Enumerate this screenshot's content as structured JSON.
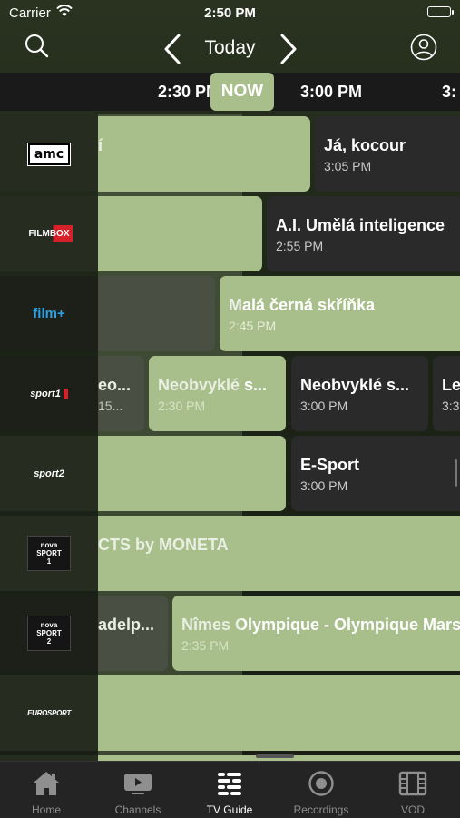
{
  "status": {
    "carrier": "Carrier",
    "time": "2:50 PM"
  },
  "header": {
    "day": "Today"
  },
  "timeline": {
    "ticks": [
      "2:30 PM",
      "3:00 PM",
      "3:"
    ],
    "now_label": "NOW"
  },
  "channels": [
    {
      "logo": "amc",
      "programs": [
        {
          "title": "í",
          "time": ""
        },
        {
          "title": "Já, kocour",
          "time": "3:05 PM"
        }
      ]
    },
    {
      "logo": "FILMBOX",
      "programs": [
        {
          "title": "",
          "time": ""
        },
        {
          "title": "A.I. Umělá inteligence",
          "time": "2:55 PM"
        }
      ]
    },
    {
      "logo": "film+",
      "programs": [
        {
          "title": "",
          "time": ""
        },
        {
          "title": "Malá černá skříňka",
          "time": "2:45 PM"
        }
      ]
    },
    {
      "logo": "sport1",
      "programs": [
        {
          "title": "eo...",
          "time": "15..."
        },
        {
          "title": "Neobvyklé s...",
          "time": "2:30 PM"
        },
        {
          "title": "Neobvyklé s...",
          "time": "3:00 PM"
        },
        {
          "title": "Le",
          "time": "3:3"
        }
      ]
    },
    {
      "logo": "sport2",
      "programs": [
        {
          "title": "",
          "time": ""
        },
        {
          "title": "E-Sport",
          "time": "3:00 PM"
        }
      ]
    },
    {
      "logo": "nova SPORT 1",
      "programs": [
        {
          "title": "CTS by MONETA",
          "time": ""
        }
      ]
    },
    {
      "logo": "nova SPORT 2",
      "programs": [
        {
          "title": "adelp...",
          "time": ""
        },
        {
          "title": "Nîmes Olympique - Olympique Mars",
          "time": "2:35 PM"
        }
      ]
    },
    {
      "logo": "EUROSPORT",
      "programs": [
        {
          "title": "",
          "time": ""
        }
      ]
    }
  ],
  "tabs": [
    {
      "label": "Home",
      "icon": "home-icon"
    },
    {
      "label": "Channels",
      "icon": "channels-icon"
    },
    {
      "label": "TV Guide",
      "icon": "tv-guide-icon"
    },
    {
      "label": "Recordings",
      "icon": "recordings-icon"
    },
    {
      "label": "VOD",
      "icon": "vod-icon"
    }
  ],
  "colors": {
    "accent": "#a8bf8c",
    "card": "#2a2a2a"
  }
}
